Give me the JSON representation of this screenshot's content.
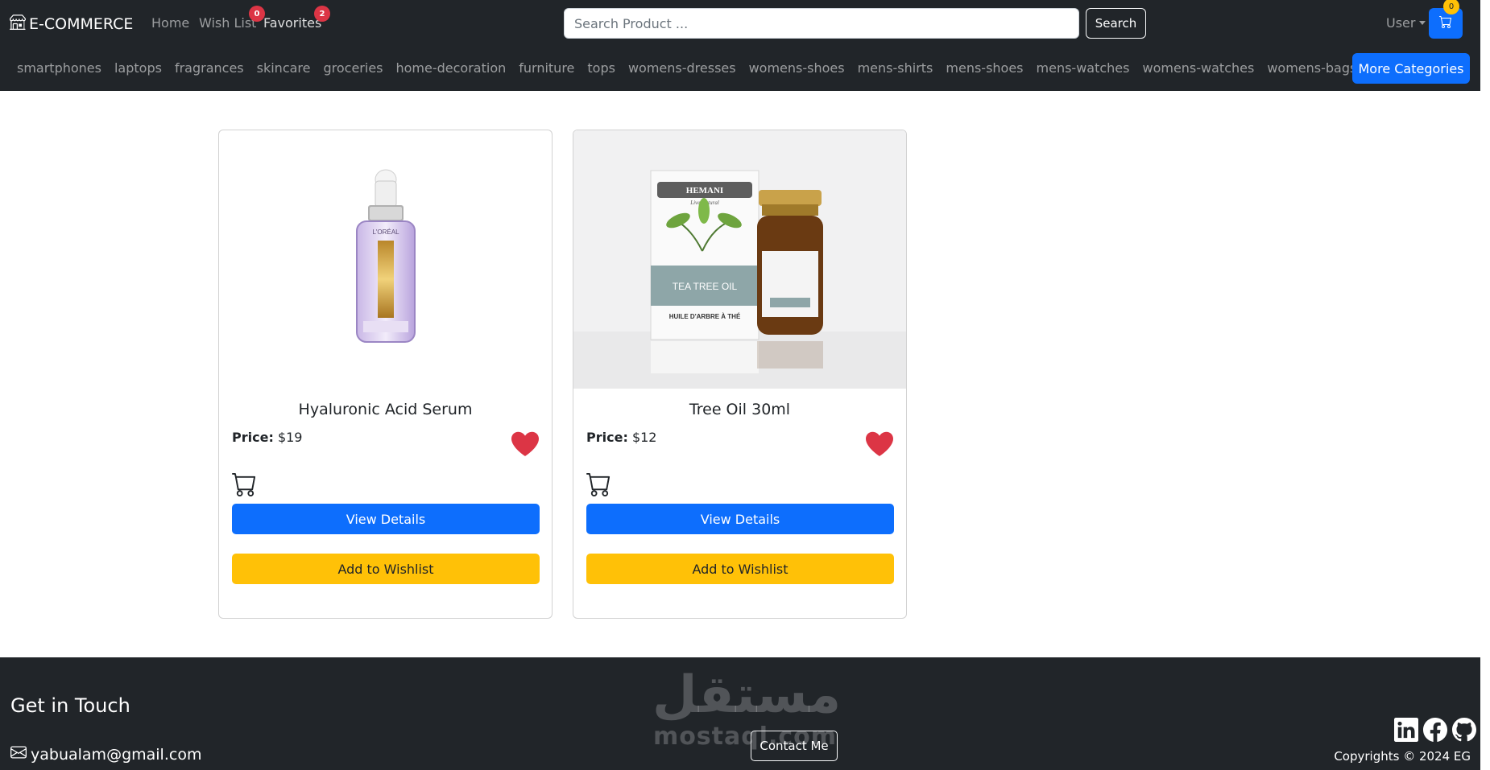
{
  "navbar": {
    "brand": "E-COMMERCE",
    "links": [
      {
        "label": "Home"
      },
      {
        "label": "Wish List",
        "badge": "0"
      },
      {
        "label": "Favorites",
        "badge": "2"
      }
    ],
    "search": {
      "placeholder": "Search Product ...",
      "button_label": "Search"
    },
    "user_label": "User",
    "cart_count": "0",
    "categories": [
      "smartphones",
      "laptops",
      "fragrances",
      "skincare",
      "groceries",
      "home-decoration",
      "furniture",
      "tops",
      "womens-dresses",
      "womens-shoes",
      "mens-shirts",
      "mens-shoes",
      "mens-watches",
      "womens-watches",
      "womens-bags"
    ],
    "more_categories_label": "More Categories"
  },
  "products": [
    {
      "title": "Hyaluronic Acid Serum",
      "price_label": "Price:",
      "price": "$19",
      "details_label": "View Details",
      "wishlist_label": "Add to Wishlist"
    },
    {
      "title": "Tree Oil 30ml",
      "price_label": "Price:",
      "price": "$12",
      "details_label": "View Details",
      "wishlist_label": "Add to Wishlist"
    }
  ],
  "product_image_text": {
    "serum_brand": "L'ORÉAL",
    "box_brand": "HEMANI",
    "box_sub": "Live Natural",
    "box_label": "TEA TREE OIL",
    "box_fr": "HUILE D'ARBRE À THÉ"
  },
  "footer": {
    "heading": "Get in Touch",
    "email": "yabualam@gmail.com",
    "watermark_arabic": "مستقل",
    "watermark_latin": "mostaql.com",
    "contact_label": "Contact Me",
    "copyright": "Copyrights © 2024 EG"
  },
  "colors": {
    "navbar_bg": "#212529",
    "primary": "#0d6efd",
    "warning": "#ffc107",
    "danger": "#dc3545"
  },
  "icons": [
    "shop-icon",
    "cart-icon",
    "heart-icon",
    "envelope-icon",
    "linkedin-icon",
    "facebook-icon",
    "github-icon"
  ]
}
